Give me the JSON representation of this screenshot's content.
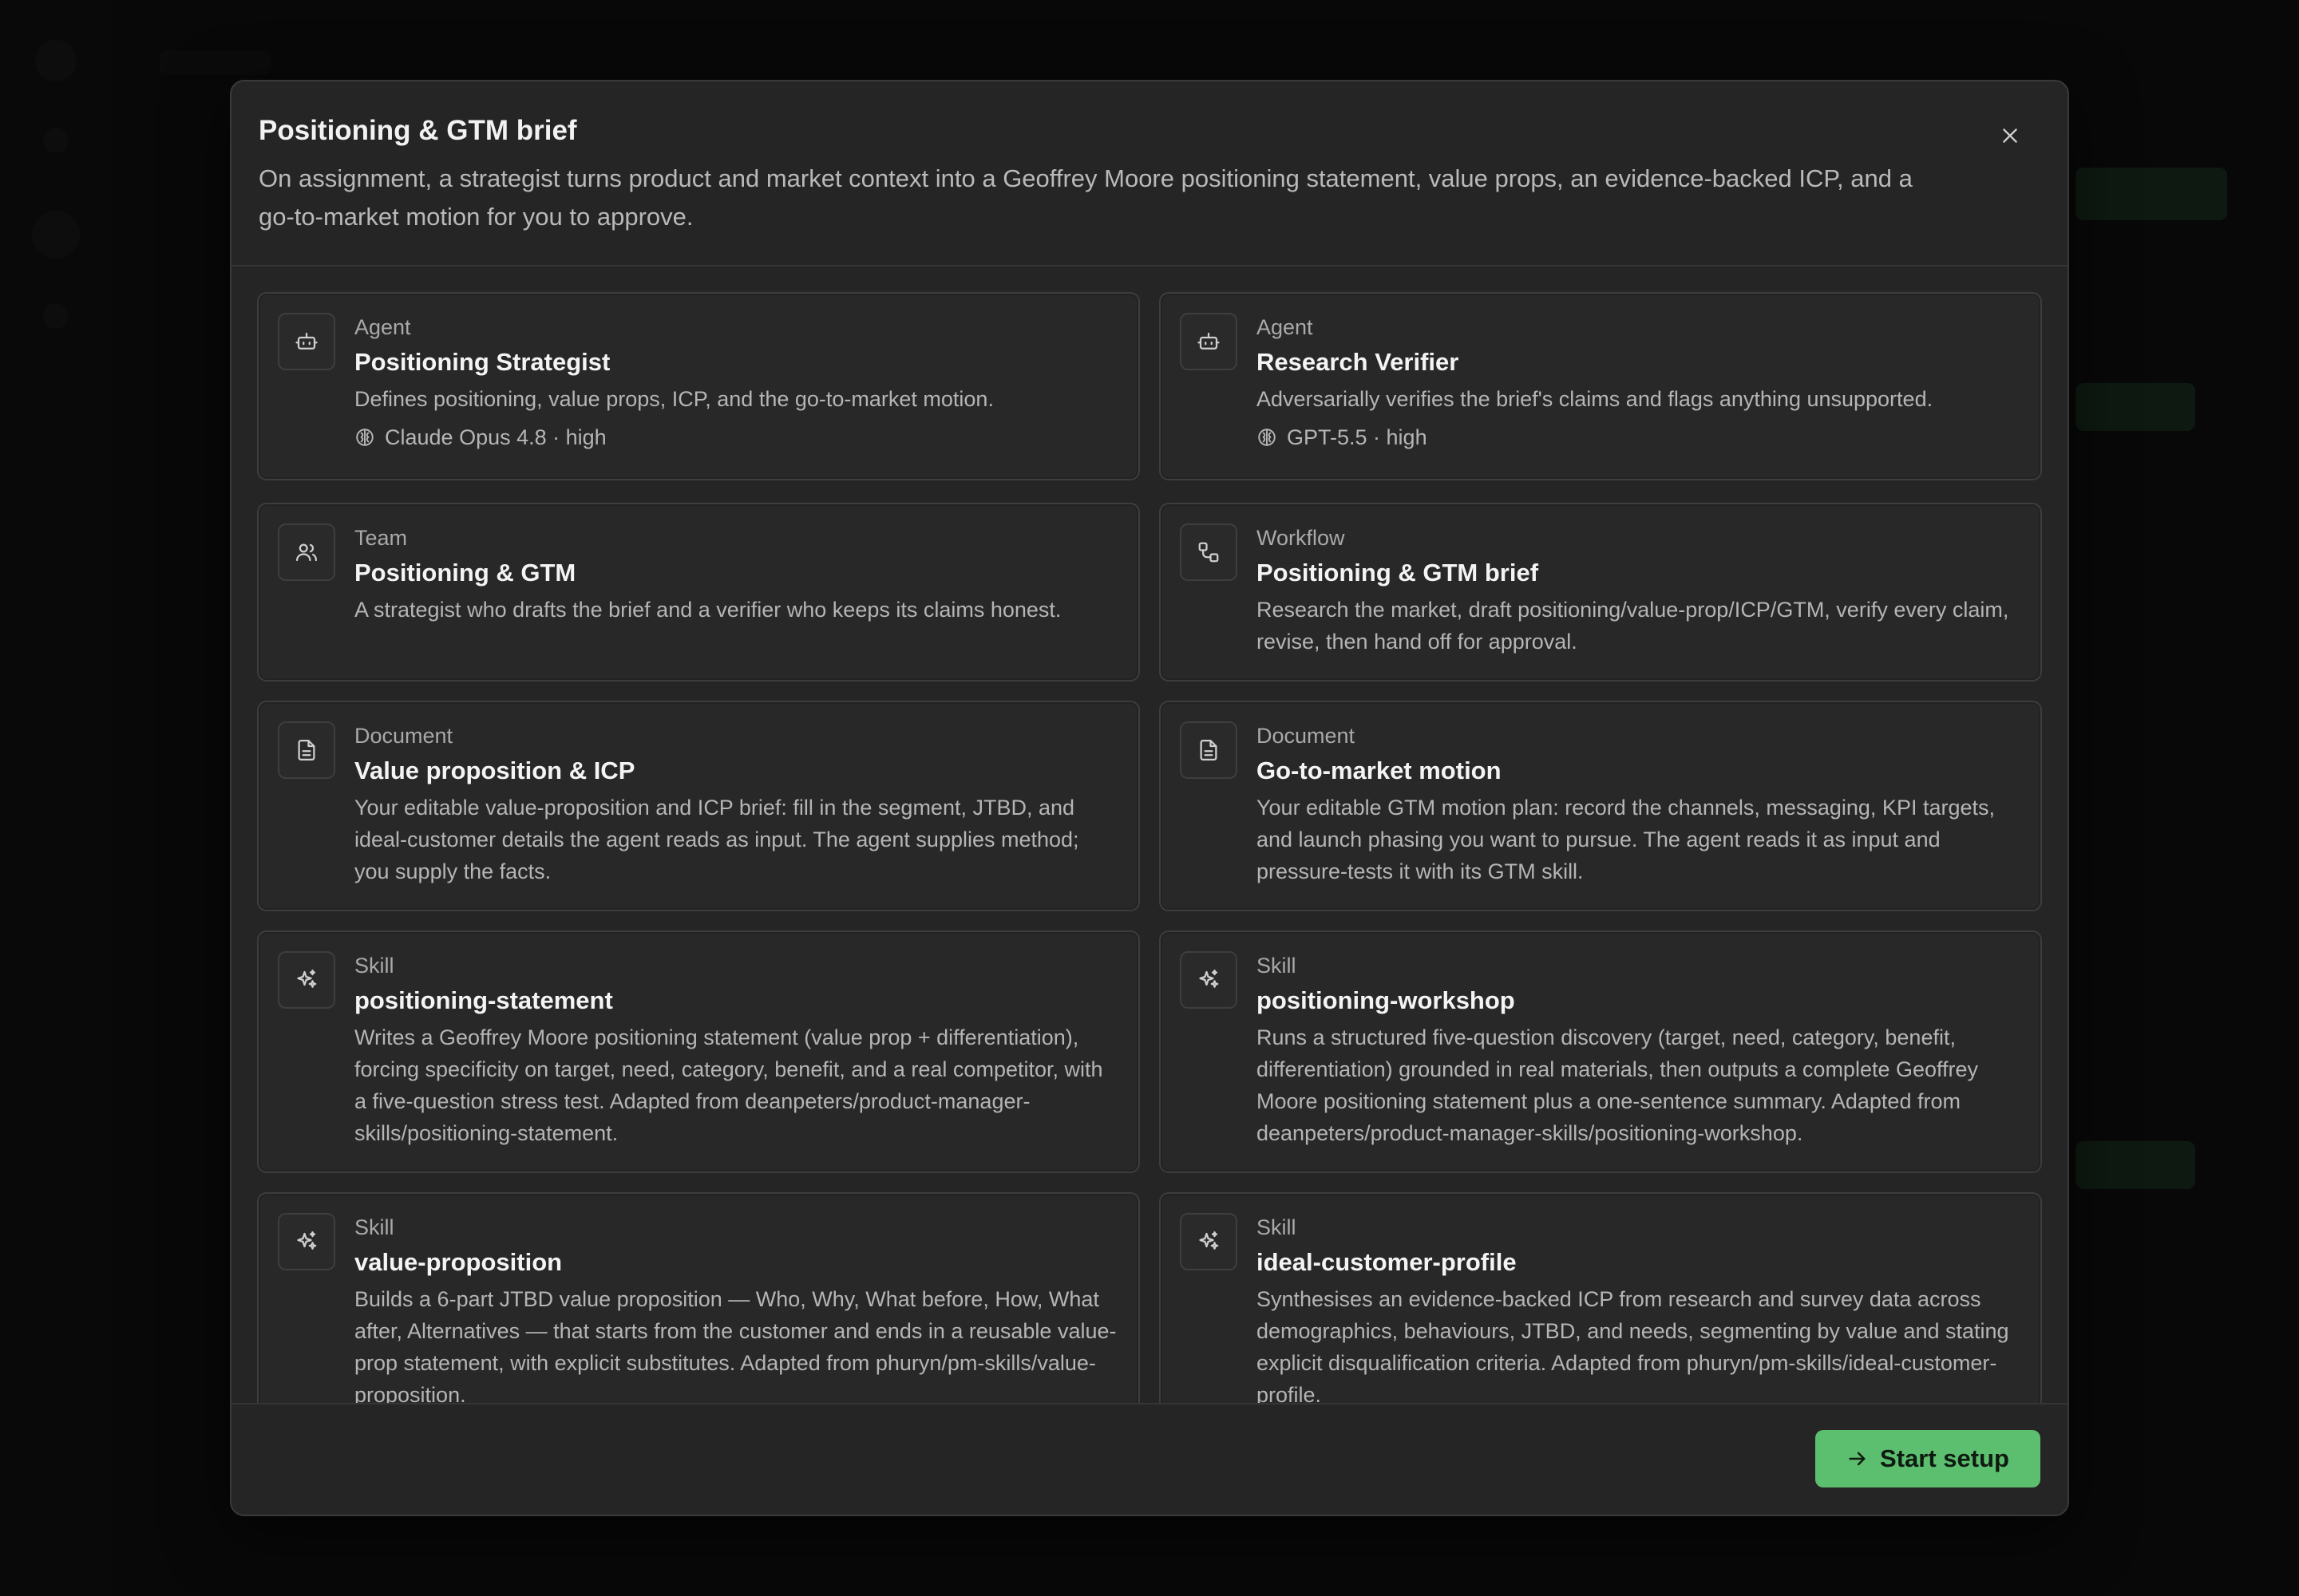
{
  "modal": {
    "title": "Positioning & GTM brief",
    "description": "On assignment, a strategist turns product and market context into a Geoffrey Moore positioning statement, value props, an evidence-backed ICP, and a go-to-market motion for you to approve.",
    "close_icon": "close-icon"
  },
  "cards": [
    {
      "type": "Agent",
      "name": "Positioning Strategist",
      "description": "Defines positioning, value props, ICP, and the go-to-market motion.",
      "model": "Claude Opus 4.8 · high",
      "icon": "bot-icon"
    },
    {
      "type": "Agent",
      "name": "Research Verifier",
      "description": "Adversarially verifies the brief's claims and flags anything unsupported.",
      "model": "GPT-5.5 · high",
      "icon": "bot-icon"
    },
    {
      "type": "Team",
      "name": "Positioning & GTM",
      "description": "A strategist who drafts the brief and a verifier who keeps its claims honest.",
      "icon": "users-icon"
    },
    {
      "type": "Workflow",
      "name": "Positioning & GTM brief",
      "description": "Research the market, draft positioning/value-prop/ICP/GTM, verify every claim, revise, then hand off for approval.",
      "icon": "workflow-icon"
    },
    {
      "type": "Document",
      "name": "Value proposition & ICP",
      "description": "Your editable value-proposition and ICP brief: fill in the segment, JTBD, and ideal-customer details the agent reads as input. The agent supplies method; you supply the facts.",
      "icon": "document-icon"
    },
    {
      "type": "Document",
      "name": "Go-to-market motion",
      "description": "Your editable GTM motion plan: record the channels, messaging, KPI targets, and launch phasing you want to pursue. The agent reads it as input and pressure-tests it with its GTM skill.",
      "icon": "document-icon"
    },
    {
      "type": "Skill",
      "name": "positioning-statement",
      "description": "Writes a Geoffrey Moore positioning statement (value prop + differentiation), forcing specificity on target, need, category, benefit, and a real competitor, with a five-question stress test. Adapted from deanpeters/product-manager-skills/positioning-statement.",
      "icon": "sparkle-icon"
    },
    {
      "type": "Skill",
      "name": "positioning-workshop",
      "description": "Runs a structured five-question discovery (target, need, category, benefit, differentiation) grounded in real materials, then outputs a complete Geoffrey Moore positioning statement plus a one-sentence summary. Adapted from deanpeters/product-manager-skills/positioning-workshop.",
      "icon": "sparkle-icon"
    },
    {
      "type": "Skill",
      "name": "value-proposition",
      "description": "Builds a 6-part JTBD value proposition — Who, Why, What before, How, What after, Alternatives — that starts from the customer and ends in a reusable value-prop statement, with explicit substitutes. Adapted from phuryn/pm-skills/value-proposition.",
      "icon": "sparkle-icon"
    },
    {
      "type": "Skill",
      "name": "ideal-customer-profile",
      "description": "Synthesises an evidence-backed ICP from research and survey data across demographics, behaviours, JTBD, and needs, segmenting by value and stating explicit disqualification criteria. Adapted from phuryn/pm-skills/ideal-customer-profile.",
      "icon": "sparkle-icon"
    }
  ],
  "footer": {
    "start_label": "Start setup",
    "start_icon": "arrow-right-icon"
  },
  "colors": {
    "accent": "#5cbf6f",
    "surface": "#252525",
    "card": "#282828"
  }
}
